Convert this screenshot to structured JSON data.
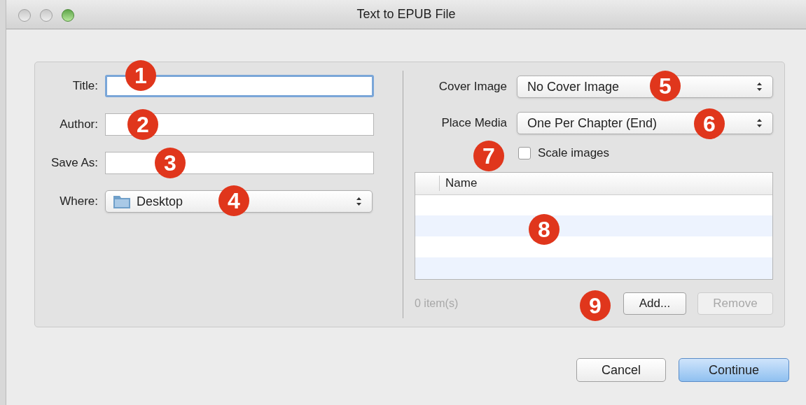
{
  "window": {
    "title": "Text to EPUB File"
  },
  "left_fields": [
    {
      "label": "Title:",
      "kind": "text",
      "focused": true
    },
    {
      "label": "Author:",
      "kind": "text",
      "focused": false
    },
    {
      "label": "Save As:",
      "kind": "text",
      "focused": false
    },
    {
      "label": "Where:",
      "kind": "folder_popup",
      "value": "Desktop"
    }
  ],
  "right_fields": [
    {
      "label": "Cover Image",
      "kind": "popup",
      "value": "No Cover Image"
    },
    {
      "label": "Place Media",
      "kind": "popup",
      "value": "One Per Chapter (End)"
    }
  ],
  "scale_images": {
    "label": "Scale images",
    "checked": false
  },
  "table": {
    "columns": [
      "Name"
    ]
  },
  "item_count": "0 item(s)",
  "list_buttons": [
    {
      "label": "Add...",
      "disabled": false
    },
    {
      "label": "Remove",
      "disabled": true
    }
  ],
  "buttons": [
    {
      "label": "Cancel",
      "default": false
    },
    {
      "label": "Continue",
      "default": true
    }
  ],
  "annotations": [
    {
      "number": "1"
    },
    {
      "number": "2"
    },
    {
      "number": "3"
    },
    {
      "number": "4"
    },
    {
      "number": "5"
    },
    {
      "number": "6"
    },
    {
      "number": "7"
    },
    {
      "number": "8"
    },
    {
      "number": "9"
    }
  ]
}
